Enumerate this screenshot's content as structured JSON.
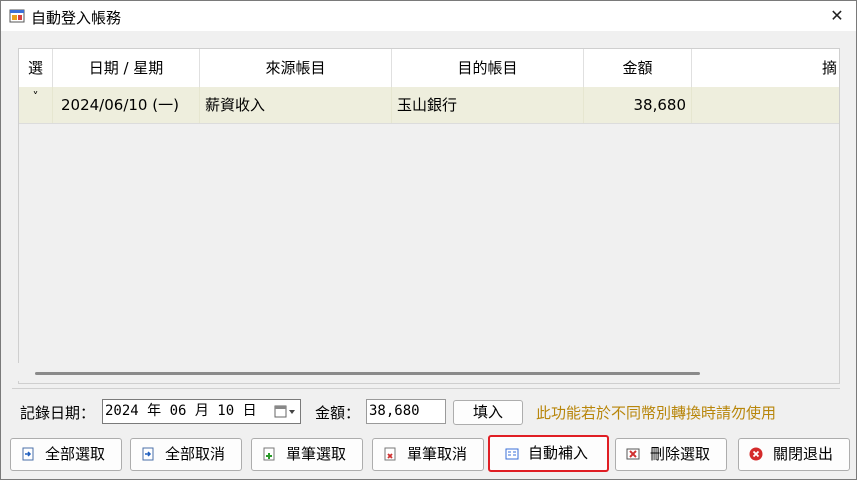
{
  "window": {
    "title": "自動登入帳務",
    "close_symbol": "✕"
  },
  "grid": {
    "columns": [
      "選",
      "日期 / 星期",
      "來源帳目",
      "目的帳目",
      "金額",
      "摘"
    ],
    "rows": [
      {
        "select": "˅",
        "date": "2024/06/10 (一)",
        "source": "薪資收入",
        "target": "玉山銀行",
        "amount": "38,680",
        "memo": ""
      }
    ]
  },
  "form": {
    "date_label": "記錄日期：",
    "date_value": "2024 年 06 月 10 日",
    "amount_label": "金額：",
    "amount_value": "38,680",
    "fill_button": "填入",
    "note": "此功能若於不同幣別轉換時請勿使用",
    "note_color": "#b8860b"
  },
  "buttons": {
    "select_all": "全部選取",
    "cancel_all": "全部取消",
    "select_one": "單筆選取",
    "cancel_one": "單筆取消",
    "auto_fill": "自動補入",
    "delete_selected": "刪除選取",
    "close_exit": "關閉退出"
  },
  "highlight_color": "#e01e24"
}
